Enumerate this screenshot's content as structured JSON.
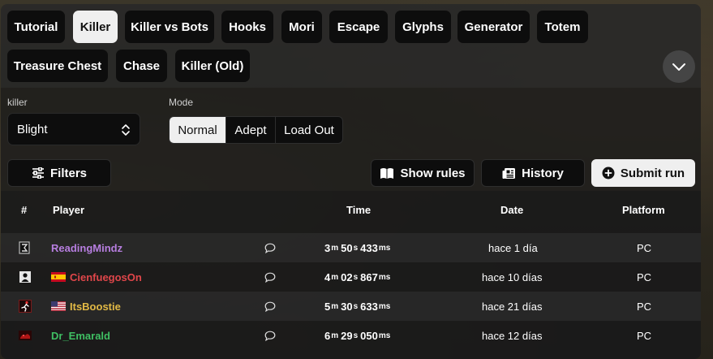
{
  "tabs": [
    "Tutorial",
    "Killer",
    "Killer vs Bots",
    "Hooks",
    "Mori",
    "Escape",
    "Glyphs",
    "Generator",
    "Totem",
    "Treasure Chest",
    "Chase",
    "Killer (Old)"
  ],
  "active_tab": "Killer",
  "filters": {
    "killer_label": "killer",
    "killer_value": "Blight",
    "mode_label": "Mode",
    "modes": [
      "Normal",
      "Adept",
      "Load Out"
    ],
    "active_mode": "Normal"
  },
  "actions": {
    "filters": "Filters",
    "show_rules": "Show rules",
    "history": "History",
    "submit_run": "Submit run"
  },
  "table": {
    "headers": {
      "rank": "#",
      "player": "Player",
      "time": "Time",
      "date": "Date",
      "platform": "Platform"
    },
    "rows": [
      {
        "player": "ReadingMindz",
        "color": "#b77ee0",
        "flag": "",
        "time": {
          "m": "3",
          "s": "50",
          "ms": "433"
        },
        "date": "hace 1 día",
        "platform": "PC",
        "icon": "rank-emblem-icon"
      },
      {
        "player": "CienfuegosOn",
        "color": "#e0464a",
        "flag": "es",
        "time": {
          "m": "4",
          "s": "02",
          "ms": "867"
        },
        "date": "hace 10 días",
        "platform": "PC",
        "icon": "player-silhouette-icon"
      },
      {
        "player": "ItsBoostie",
        "color": "#e2b945",
        "flag": "us",
        "time": {
          "m": "5",
          "s": "30",
          "ms": "633"
        },
        "date": "hace 21 días",
        "platform": "PC",
        "icon": "runner-icon"
      },
      {
        "player": "Dr_Emarald",
        "color": "#3fbf63",
        "flag": "",
        "time": {
          "m": "6",
          "s": "29",
          "ms": "050"
        },
        "date": "hace 12 días",
        "platform": "PC",
        "icon": "bloody-avatar-icon"
      }
    ],
    "units": {
      "m": "m",
      "s": "s",
      "ms": "ms"
    }
  }
}
